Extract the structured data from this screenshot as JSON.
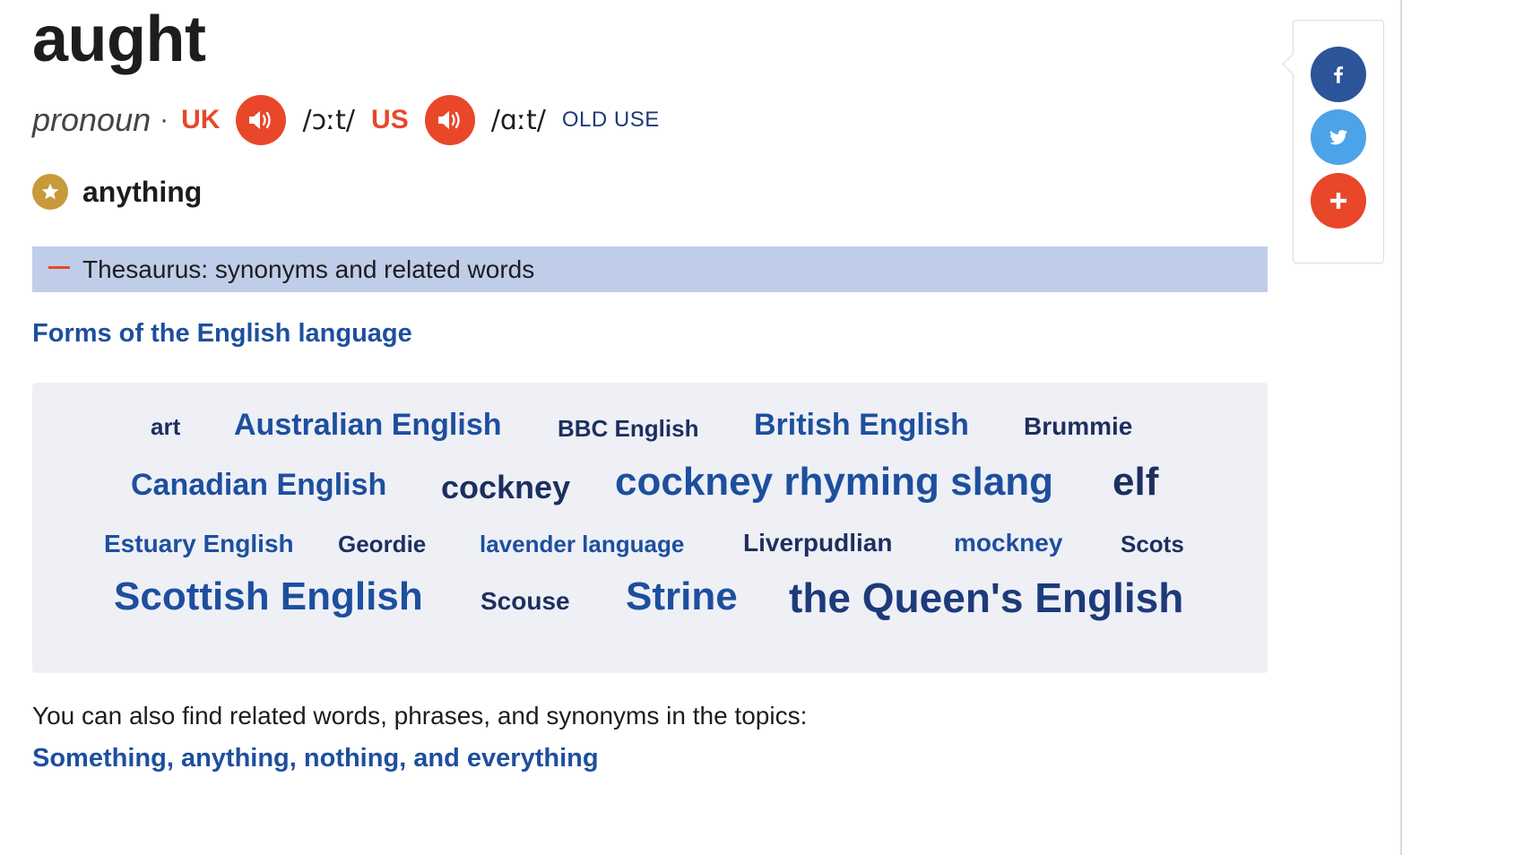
{
  "entry": {
    "headword": "aught",
    "part_of_speech": "pronoun",
    "separator": "·",
    "uk": {
      "label": "UK",
      "ipa": "/ɔːt/"
    },
    "us": {
      "label": "US",
      "ipa": "/ɑːt/"
    },
    "usage": "OLD USE",
    "definition": "anything"
  },
  "thesaurus": {
    "toggle_symbol": "—",
    "label": "Thesaurus: synonyms and related words",
    "heading": "Forms of the English language",
    "words": [
      "art",
      "Australian English",
      "BBC English",
      "British English",
      "Brummie",
      "Canadian English",
      "cockney",
      "cockney rhyming slang",
      "elf",
      "Estuary English",
      "Geordie",
      "lavender language",
      "Liverpudlian",
      "mockney",
      "Scots",
      "Scottish English",
      "Scouse",
      "Strine",
      "the Queen's English"
    ]
  },
  "topics": {
    "intro": "You can also find related words, phrases, and synonyms in the topics:",
    "link": "Something, anything, nothing, and everything"
  },
  "share": {
    "buttons": [
      "facebook-icon",
      "twitter-icon",
      "plus-icon"
    ]
  },
  "colors": {
    "accent_red": "#e8472a",
    "link_blue": "#1d4f9e",
    "dark_navy": "#1d2f5e",
    "thesaurus_bar": "#bfcde9",
    "cloud_bg": "#eef0f6",
    "star_gold": "#c79a3b",
    "facebook": "#2c5499",
    "twitter": "#4da3e8"
  }
}
